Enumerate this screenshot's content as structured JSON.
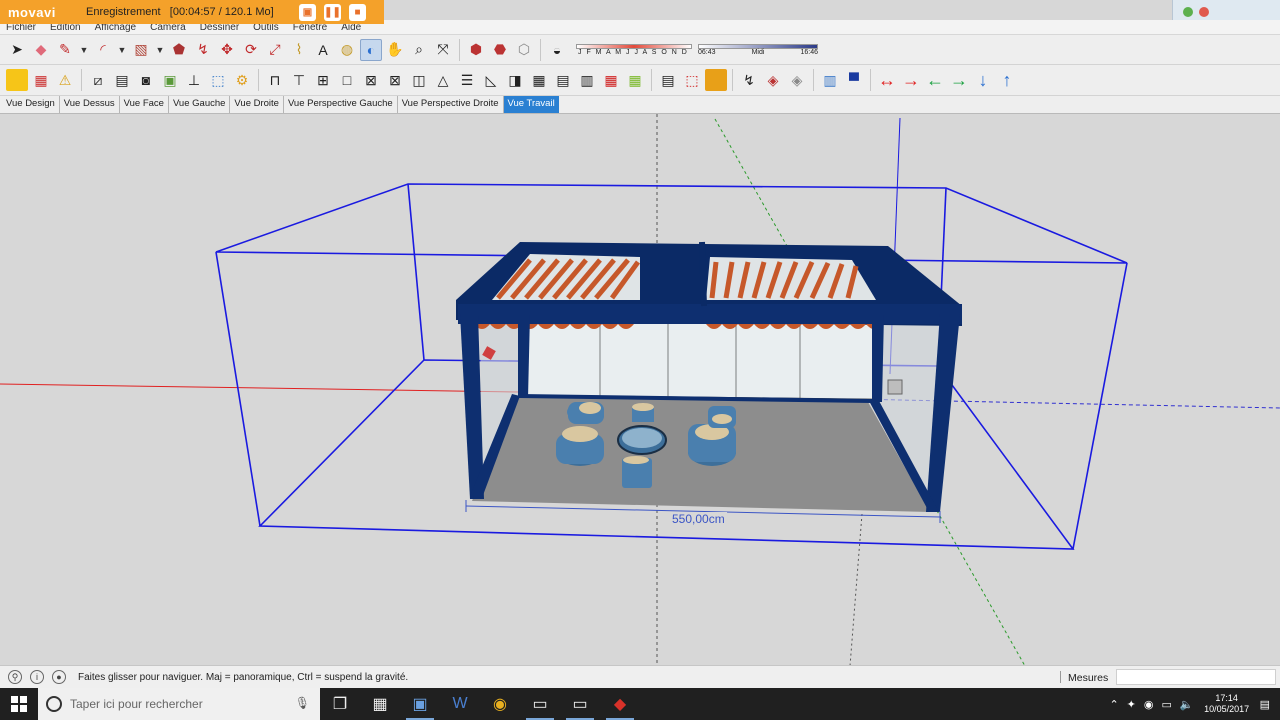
{
  "recording": {
    "logo": "movavi",
    "status_text": "Enregistrement",
    "time_size": "[00:04:57 / 120.1 Mo]",
    "accent": "#f4a12a"
  },
  "menu": [
    "Fichier",
    "Edition",
    "Affichage",
    "Camera",
    "Dessiner",
    "Outils",
    "Fenetre",
    "Aide"
  ],
  "shadows": {
    "months": "J F M A M J J A S O N D",
    "time_start": "06:43",
    "time_mid": "Midi",
    "time_end": "16:46"
  },
  "scene_tabs": [
    {
      "label": "Vue Design"
    },
    {
      "label": "Vue Dessus"
    },
    {
      "label": "Vue Face"
    },
    {
      "label": "Vue Gauche"
    },
    {
      "label": "Vue Droite"
    },
    {
      "label": "Vue Perspective Gauche"
    },
    {
      "label": "Vue Perspective Droite"
    },
    {
      "label": "Vue Travail",
      "active": true
    }
  ],
  "viewport": {
    "dimension_label": "550,00cm",
    "background": "#d7d7d7",
    "bounding_color": "#1a1ae0",
    "frame_color": "#0b2a66",
    "awning_color": "#c6582a"
  },
  "status": {
    "hint": "Faites glisser pour naviguer. Maj = panoramique, Ctrl =  suspend la gravité.",
    "measures_label": "Mesures",
    "measures_value": ""
  },
  "taskbar": {
    "search_placeholder": "Taper ici pour rechercher",
    "time": "17:14",
    "date": "10/05/2017"
  }
}
